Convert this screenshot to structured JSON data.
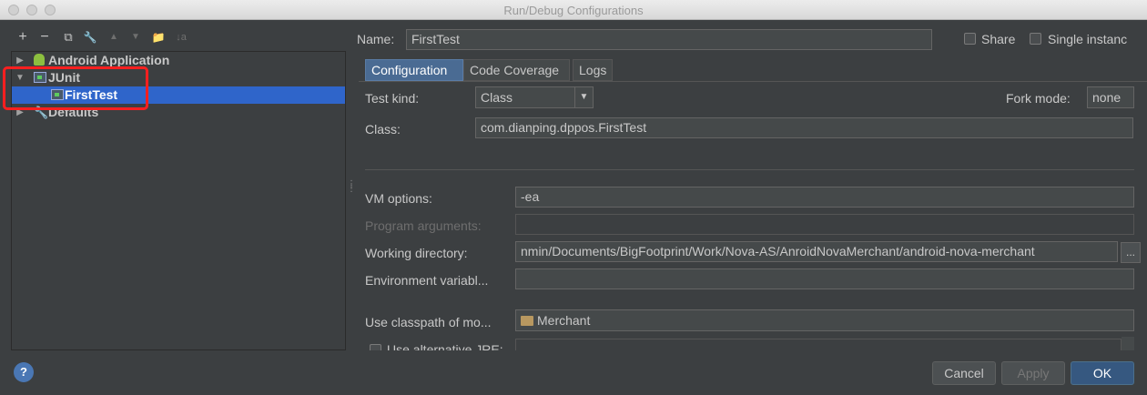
{
  "window": {
    "title": "Run/Debug Configurations"
  },
  "toolbar": {
    "add": "+",
    "remove": "−",
    "copy": "⧉",
    "edit_defaults": "🔧",
    "move_up": "▲",
    "move_down": "▼",
    "folder": "📁",
    "sort": "↓a"
  },
  "tree": {
    "android": "Android Application",
    "junit": "JUnit",
    "firsttest": "FirstTest",
    "defaults": "Defaults"
  },
  "header": {
    "name_label": "Name:",
    "name_value": "FirstTest",
    "share_label": "Share",
    "single_instance_label": "Single instanc"
  },
  "tabs": [
    "Configuration",
    "Code Coverage",
    "Logs"
  ],
  "config": {
    "test_kind_label": "Test kind:",
    "test_kind_value": "Class",
    "fork_mode_label": "Fork mode:",
    "fork_mode_value": "none",
    "class_label": "Class:",
    "class_value": "com.dianping.dppos.FirstTest",
    "vm_label": "VM options:",
    "vm_value": "-ea",
    "program_args_label": "Program arguments:",
    "program_args_value": "",
    "working_dir_label": "Working directory:",
    "working_dir_value": "nmin/Documents/BigFootprint/Work/Nova-AS/AnroidNovaMerchant/android-nova-merchant",
    "browse": "...",
    "env_label": "Environment variabl...",
    "env_value": "",
    "classpath_label": "Use classpath of mo...",
    "classpath_value": "Merchant",
    "alt_jre_label": "Use alternative JRE:"
  },
  "buttons": {
    "help": "?",
    "cancel": "Cancel",
    "apply": "Apply",
    "ok": "OK"
  },
  "colors": {
    "highlight": "#ff1f1f",
    "selection": "#2f65ca",
    "active_tab": "#4a6b93",
    "primary": "#365880"
  }
}
